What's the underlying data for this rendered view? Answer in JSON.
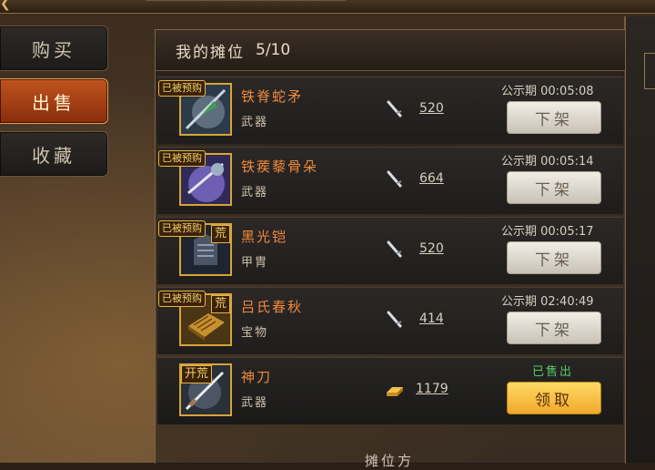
{
  "nav": {
    "items": [
      {
        "label": "购买",
        "active": false
      },
      {
        "label": "出售",
        "active": true
      },
      {
        "label": "收藏",
        "active": false
      }
    ]
  },
  "header": {
    "title": "我的摊位",
    "count": "5/10"
  },
  "listings": [
    {
      "name": "铁脊蛇矛",
      "type": "武器",
      "price": "520",
      "price_icon": "dagger-icon",
      "badge": "已被预购",
      "tag": "",
      "status": "公示期 00:05:08",
      "action": "下架"
    },
    {
      "name": "铁蒺藜骨朵",
      "type": "武器",
      "price": "664",
      "price_icon": "dagger-icon",
      "badge": "已被预购",
      "tag": "",
      "status": "公示期 00:05:14",
      "action": "下架"
    },
    {
      "name": "黑光铠",
      "type": "甲胄",
      "price": "520",
      "price_icon": "dagger-icon",
      "badge": "已被预购",
      "tag": "荒",
      "status": "公示期 00:05:17",
      "action": "下架"
    },
    {
      "name": "吕氏春秋",
      "type": "宝物",
      "price": "414",
      "price_icon": "dagger-icon",
      "badge": "已被预购",
      "tag": "荒",
      "status": "公示期 02:40:49",
      "action": "下架"
    },
    {
      "name": "神刀",
      "type": "武器",
      "price": "1179",
      "price_icon": "gold-ingot-icon",
      "badge": "",
      "tag": "开荒",
      "status": "已售出",
      "action": "领取"
    }
  ],
  "footer": {
    "text": "摊位方"
  },
  "colors": {
    "accent": "#f08a3c",
    "active_tab": "#c0541c",
    "claim_button": "#f0a92a",
    "sold_status": "#58c86a",
    "frame_gold": "#d7a437"
  }
}
